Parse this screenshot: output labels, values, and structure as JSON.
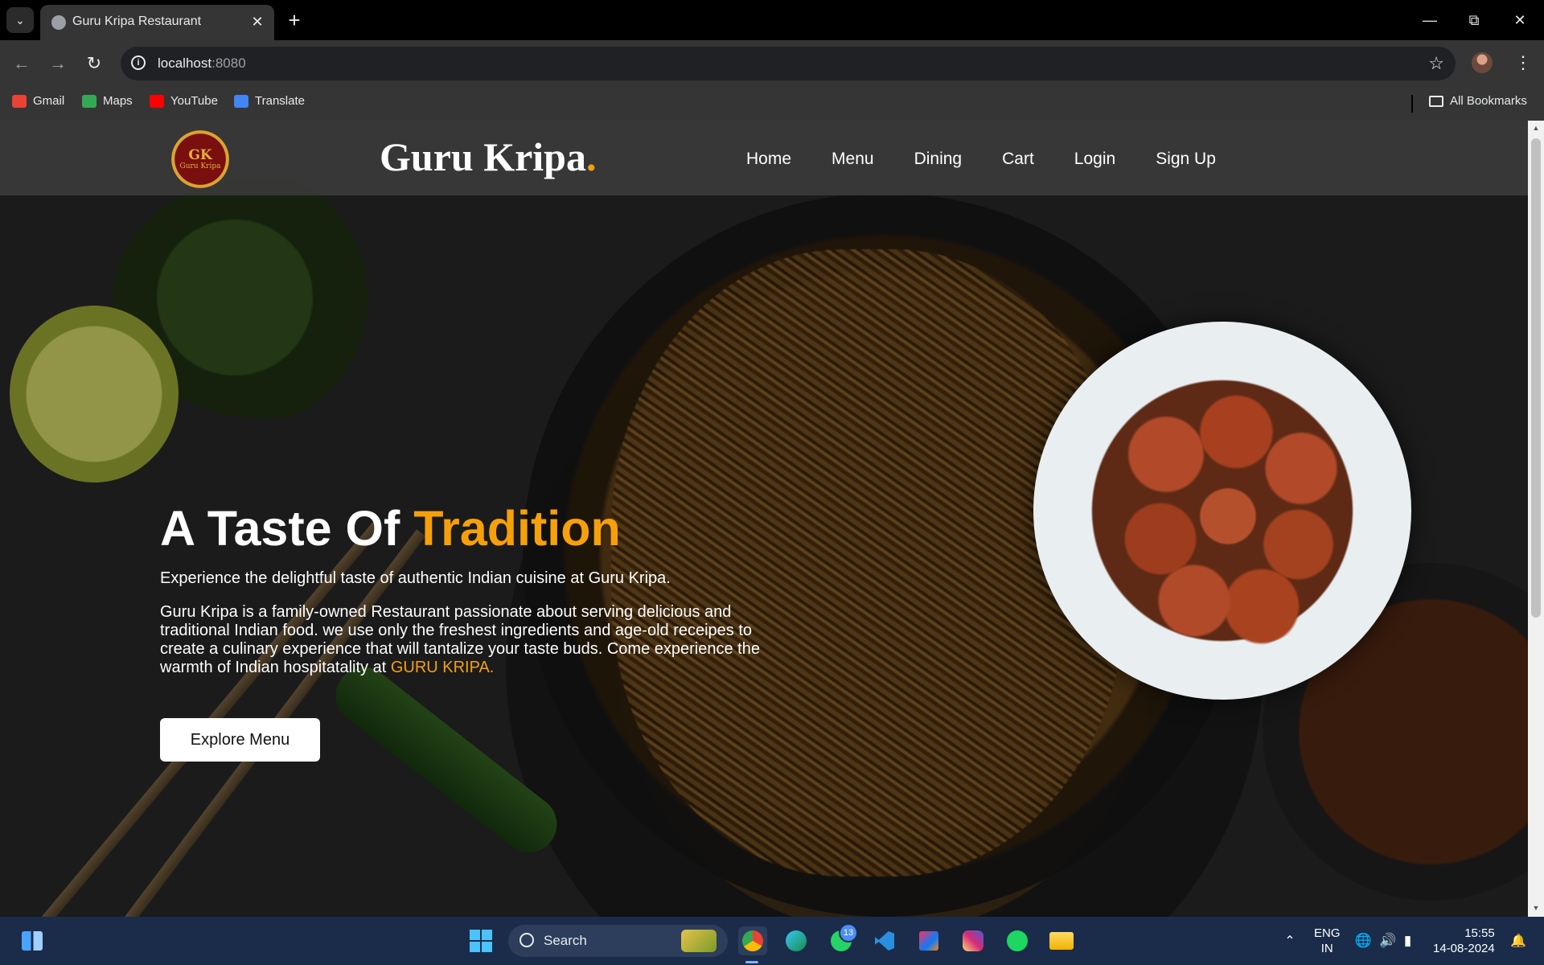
{
  "browser": {
    "tab_title": "Guru Kripa Restaurant",
    "new_tab_label": "+",
    "url_host": "localhost",
    "url_port": ":8080",
    "bookmarks": [
      {
        "label": "Gmail",
        "color": "#ea4335"
      },
      {
        "label": "Maps",
        "color": "#34a853"
      },
      {
        "label": "YouTube",
        "color": "#ff0000"
      },
      {
        "label": "Translate",
        "color": "#4285f4"
      }
    ],
    "all_bookmarks": "All Bookmarks"
  },
  "site": {
    "logo_monogram": "GK",
    "logo_text": "Guru Kripa",
    "brand_name": "Guru Kripa",
    "brand_dot": ".",
    "nav": [
      "Home",
      "Menu",
      "Dining",
      "Cart",
      "Login",
      "Sign Up"
    ],
    "accent_color": "#f5a00b"
  },
  "hero": {
    "title_start": "A Taste Of ",
    "title_accent": "Tradition",
    "subtitle": "Experience the delightful taste of authentic Indian cuisine at Guru Kripa.",
    "description": "Guru Kripa is a family-owned Restaurant passionate about serving delicious and traditional Indian food. we use only the freshest ingredients and age-old receipes to create a culinary experience that will tantalize your taste buds. Come experience the warmth of Indian hospitatality at ",
    "description_accent": "GURU KRIPA.",
    "cta_label": "Explore Menu"
  },
  "taskbar": {
    "search_label": "Search",
    "whatsapp_badge": "13",
    "lang_line1": "ENG",
    "lang_line2": "IN",
    "time": "15:55",
    "date": "14-08-2024"
  }
}
